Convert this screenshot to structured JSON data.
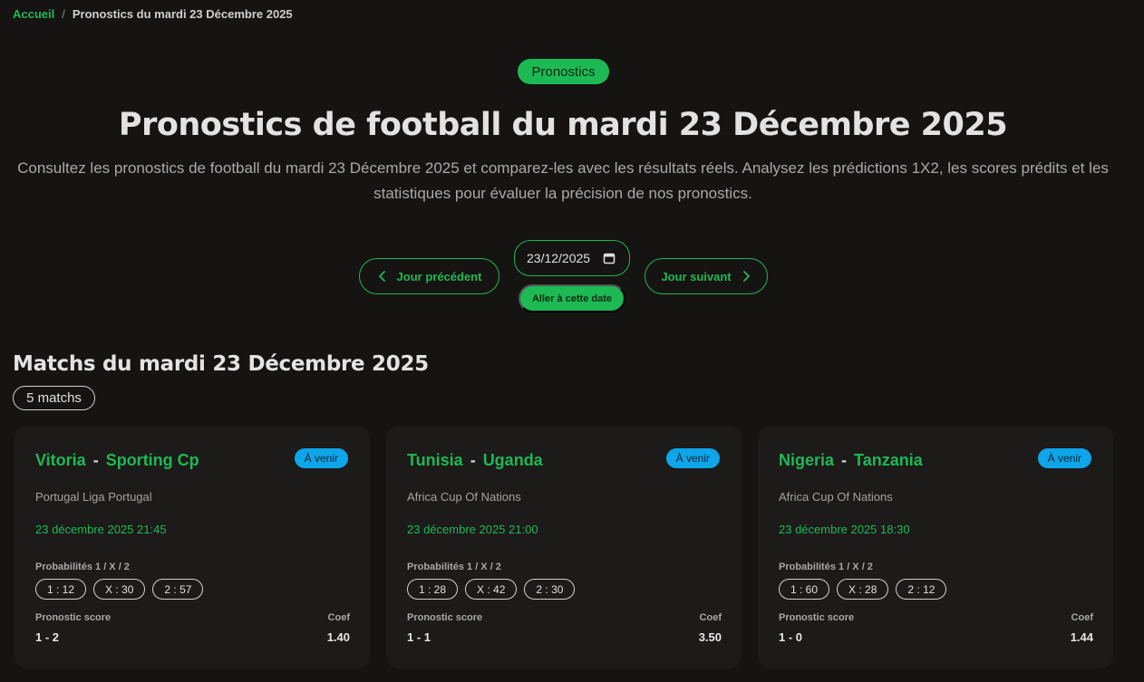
{
  "breadcrumb": {
    "home": "Accueil",
    "separator": "/",
    "current": "Pronostics du mardi 23 Décembre 2025"
  },
  "header": {
    "badge": "Pronostics",
    "title": "Pronostics de football du mardi 23 Décembre 2025",
    "intro": "Consultez les pronostics de football du mardi 23 Décembre 2025 et comparez-les avec les résultats réels. Analysez les prédictions 1X2, les scores prédits et les statistiques pour évaluer la précision de nos pronostics."
  },
  "date_nav": {
    "prev_label": "Jour précédent",
    "next_label": "Jour suivant",
    "date_value": "23/12/2025",
    "go_label": "Aller à cette date"
  },
  "matches_section": {
    "title": "Matchs du mardi 23 Décembre 2025",
    "count": "5 matchs"
  },
  "labels": {
    "probabilities": "Probabilités 1 / X / 2",
    "score": "Pronostic score",
    "coef": "Coef",
    "dash": "-"
  },
  "colors": {
    "accent": "#1db954",
    "status": "#0ea5e9",
    "background": "#161313",
    "card": "#1d1a1a"
  },
  "matches": [
    {
      "home": "Vitoria",
      "away": "Sporting Cp",
      "status": "À venir",
      "league": "Portugal Liga Portugal",
      "datetime": "23 décembre 2025 21:45",
      "p1": "1 : 12",
      "px": "X : 30",
      "p2": "2 : 57",
      "score": "1 - 2",
      "coef": "1.40"
    },
    {
      "home": "Tunisia",
      "away": "Uganda",
      "status": "À venir",
      "league": "Africa Cup Of Nations",
      "datetime": "23 décembre 2025 21:00",
      "p1": "1 : 28",
      "px": "X : 42",
      "p2": "2 : 30",
      "score": "1 - 1",
      "coef": "3.50"
    },
    {
      "home": "Nigeria",
      "away": "Tanzania",
      "status": "À venir",
      "league": "Africa Cup Of Nations",
      "datetime": "23 décembre 2025 18:30",
      "p1": "1 : 60",
      "px": "X : 28",
      "p2": "2 : 12",
      "score": "1 - 0",
      "coef": "1.44"
    }
  ]
}
